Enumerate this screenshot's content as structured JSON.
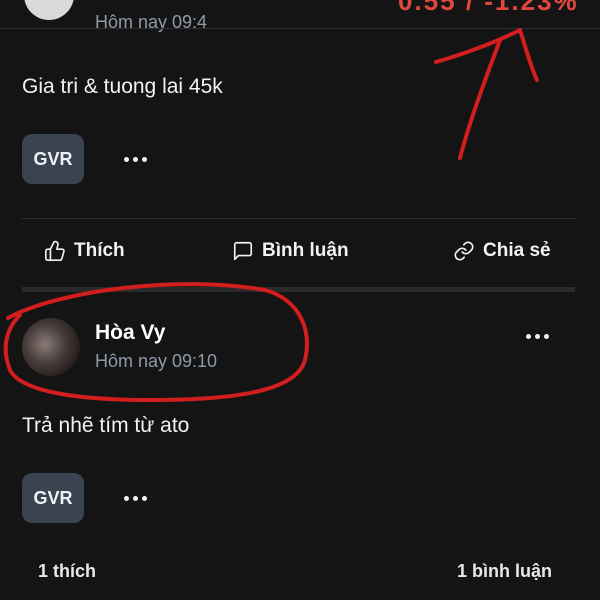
{
  "prev_post": {
    "time_partial": "Hôm nay 09:4",
    "price_partial": "0.55 / -1.23%",
    "content": "Gia tri & tuong lai 45k",
    "tag": "GVR",
    "actions": {
      "like": "Thích",
      "comment": "Bình luận",
      "share": "Chia sẻ"
    }
  },
  "post": {
    "user_name": "Hòa Vy",
    "time": "Hôm nay 09:10",
    "content": "Trả nhẽ tím từ ato",
    "tag": "GVR",
    "likes": "1 thích",
    "comments": "1 bình luận"
  },
  "colors": {
    "background": "#141414",
    "annotation_red": "#d21e1e",
    "tag_bg": "#3a4350"
  }
}
